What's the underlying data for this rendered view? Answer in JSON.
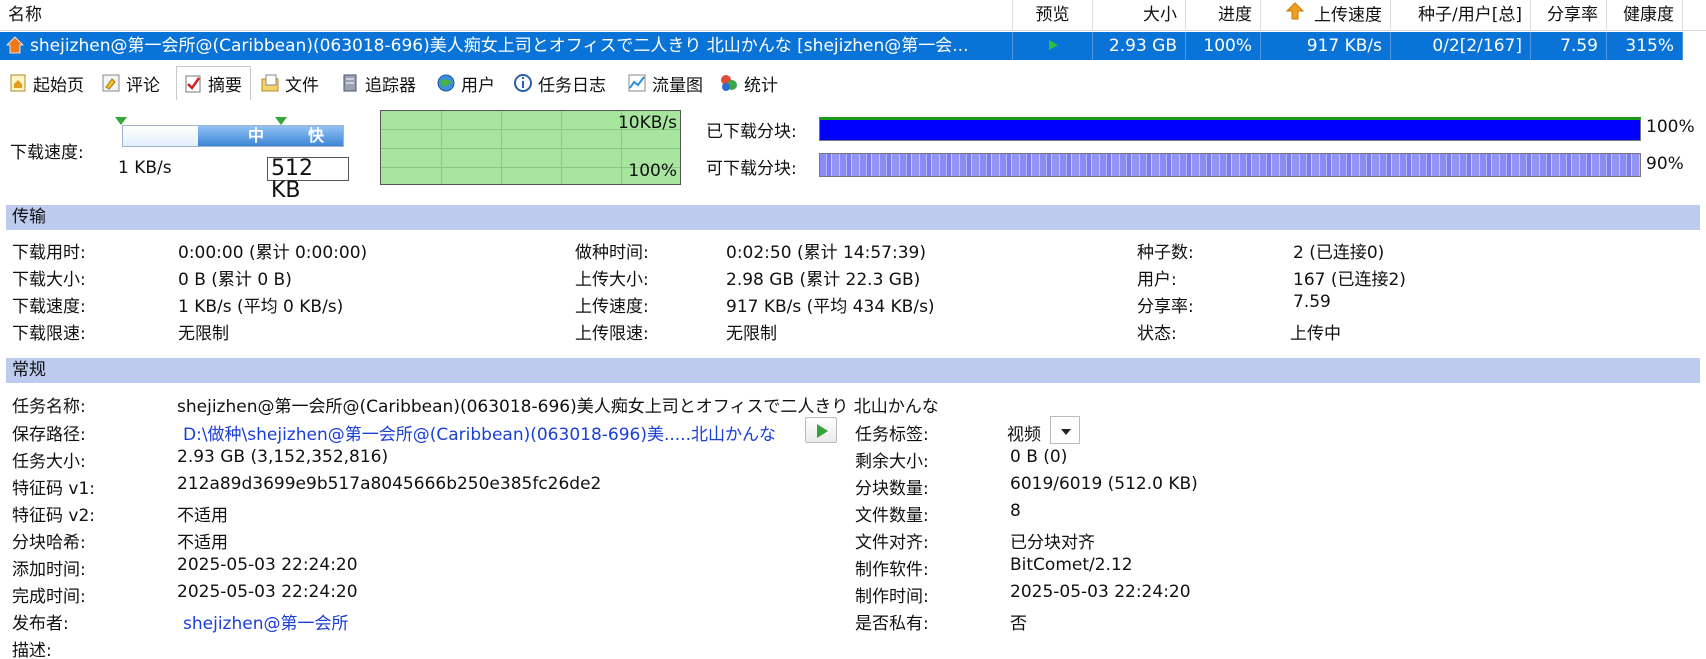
{
  "list": {
    "headers": {
      "name": "名称",
      "preview": "预览",
      "size": "大小",
      "progress": "进度",
      "upload_speed": "上传速度",
      "seeds_peers": "种子/用户[总]",
      "share_ratio": "分享率",
      "health": "健康度"
    },
    "task": {
      "icon": "upload-house-icon",
      "name": "shejizhen@第一会所@(Caribbean)(063018-696)美人痴女上司とオフィスで二人きり 北山かんな [shejizhen@第一会...",
      "preview_icon": "play-icon",
      "size": "2.93 GB",
      "progress": "100%",
      "upload_speed": "917 KB/s",
      "seeds_peers": "0/2[2/167]",
      "share_ratio": "7.59",
      "health": "315%"
    }
  },
  "tabs": [
    {
      "label": "起始页",
      "icon": "home-page-icon"
    },
    {
      "label": "评论",
      "icon": "comment-icon"
    },
    {
      "label": "摘要",
      "icon": "summary-check-icon"
    },
    {
      "label": "文件",
      "icon": "file-icon"
    },
    {
      "label": "追踪器",
      "icon": "tracker-server-icon"
    },
    {
      "label": "用户",
      "icon": "globe-users-icon"
    },
    {
      "label": "任务日志",
      "icon": "info-log-icon"
    },
    {
      "label": "流量图",
      "icon": "traffic-graph-icon"
    },
    {
      "label": "统计",
      "icon": "statistics-icon"
    }
  ],
  "speed": {
    "label": "下载速度:",
    "mid_label": "中",
    "fast_label": "快",
    "min_value": "1 KB/s",
    "input_value": "512 KB",
    "graph_top_label": "10KB/s",
    "graph_bottom_label": "100%"
  },
  "pieces": {
    "downloaded_label": "已下载分块:",
    "downloaded_pct": "100%",
    "available_label": "可下载分块:",
    "available_pct": "90%"
  },
  "transfer": {
    "title": "传输",
    "col1": [
      {
        "label": "下载用时:",
        "value": "0:00:00 (累计 0:00:00)"
      },
      {
        "label": "下载大小:",
        "value": "0 B (累计 0 B)"
      },
      {
        "label": "下载速度:",
        "value": "1 KB/s (平均 0 KB/s)"
      },
      {
        "label": "下载限速:",
        "value": "无限制"
      }
    ],
    "col2": [
      {
        "label": "做种时间:",
        "value": "0:02:50 (累计 14:57:39)"
      },
      {
        "label": "上传大小:",
        "value": "2.98 GB (累计 22.3 GB)"
      },
      {
        "label": "上传速度:",
        "value": "917 KB/s (平均 434 KB/s)"
      },
      {
        "label": "上传限速:",
        "value": "无限制"
      }
    ],
    "col3": [
      {
        "label": "种子数:",
        "value": "2 (已连接0)"
      },
      {
        "label": "用户:",
        "value": "167 (已连接2)"
      },
      {
        "label": "分享率:",
        "value": "7.59"
      },
      {
        "label": "状态:",
        "value": "上传中"
      }
    ]
  },
  "general": {
    "title": "常规",
    "task_name_label": "任务名称:",
    "task_name": "shejizhen@第一会所@(Caribbean)(063018-696)美人痴女上司とオフィスで二人きり 北山かんな",
    "save_path_label": "保存路径:",
    "save_path": "D:\\做种\\shejizhen@第一会所@(Caribbean)(063018-696)美.....北山かんな",
    "task_tag_label": "任务标签:",
    "task_tag": "视频",
    "left": [
      {
        "label": "任务大小:",
        "value": "2.93 GB (3,152,352,816)"
      },
      {
        "label": "特征码 v1:",
        "value": "212a89d3699e9b517a8045666b250e385fc26de2"
      },
      {
        "label": "特征码 v2:",
        "value": "不适用"
      },
      {
        "label": "分块哈希:",
        "value": "不适用"
      },
      {
        "label": "添加时间:",
        "value": "2025-05-03 22:24:20"
      },
      {
        "label": "完成时间:",
        "value": "2025-05-03 22:24:20"
      }
    ],
    "right": [
      {
        "label": "剩余大小:",
        "value": "0 B (0)"
      },
      {
        "label": "分块数量:",
        "value": "6019/6019 (512.0 KB)"
      },
      {
        "label": "文件数量:",
        "value": "8"
      },
      {
        "label": "文件对齐:",
        "value": "已分块对齐"
      },
      {
        "label": "制作软件:",
        "value": "BitComet/2.12"
      },
      {
        "label": "制作时间:",
        "value": "2025-05-03 22:24:20"
      },
      {
        "label": "是否私有:",
        "value": "否"
      }
    ],
    "publisher_label": "发布者:",
    "publisher": "shejizhen@第一会所",
    "description_label": "描述:"
  },
  "colors": {
    "selection": "#0a73d7",
    "section_header": "#bdcbef",
    "graph_bg": "#a8e6a0",
    "piece_full": "#0000ff",
    "link": "#1a3fd8"
  }
}
